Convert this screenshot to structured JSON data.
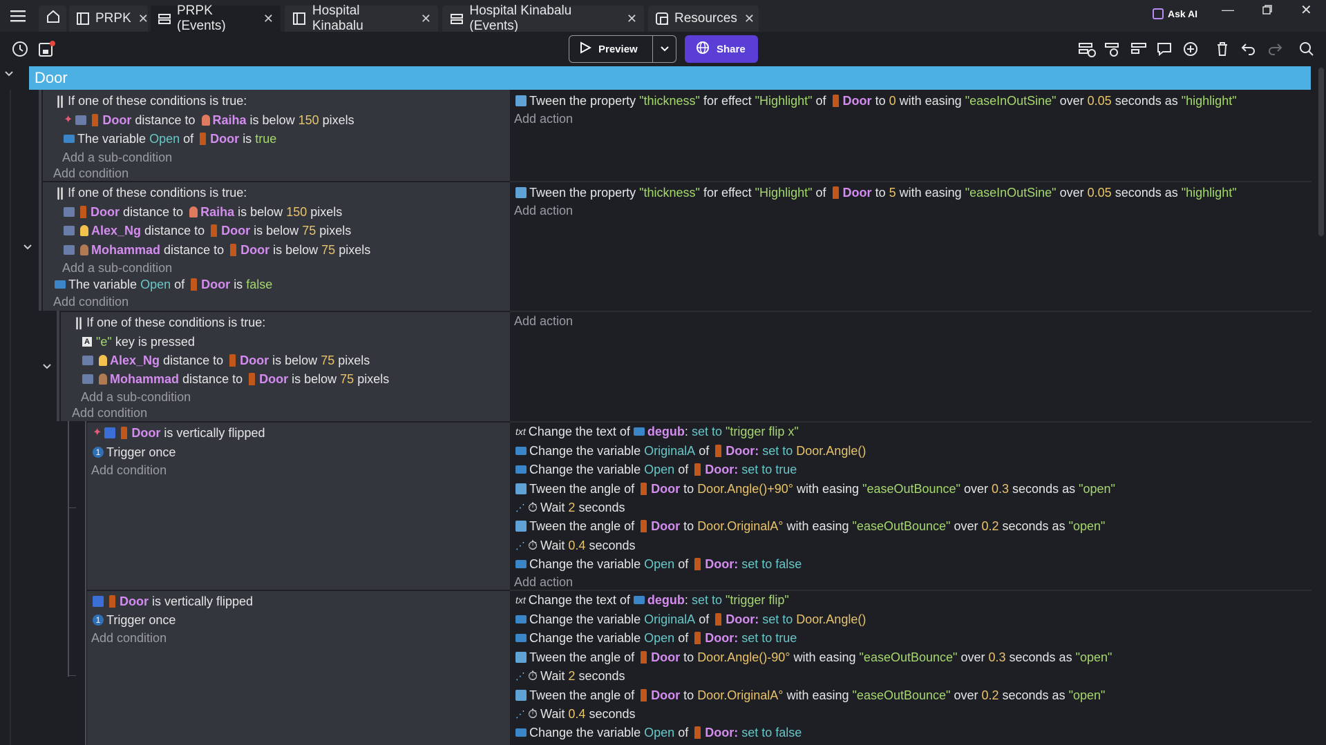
{
  "tabs": [
    {
      "label": "PRPK"
    },
    {
      "label": "PRPK (Events)"
    },
    {
      "label": "Hospital Kinabalu"
    },
    {
      "label": "Hospital Kinabalu (Events)"
    },
    {
      "label": "Resources"
    }
  ],
  "titlebar": {
    "ask_ai": "Ask AI"
  },
  "toolbar": {
    "preview": "Preview",
    "share": "Share"
  },
  "group": {
    "title": "Door"
  },
  "common": {
    "add_condition": "Add condition",
    "add_action": "Add action",
    "add_subcondition": "Add a sub-condition",
    "or_header": "If one of these conditions is true:"
  },
  "text": {
    "door": "Door",
    "raiha": "Raiha",
    "alex": "Alex_Ng",
    "mohammad": "Mohammad",
    "distance_to": "distance to",
    "is_below": "is below",
    "pixels": "pixels",
    "the_variable": "The variable",
    "of": "of",
    "is": "is",
    "open": "Open",
    "originalA": "OriginalA",
    "true": "true",
    "false": "false",
    "n150": "150",
    "n75": "75",
    "n0": "0",
    "n5": "5",
    "key_e": "\"e\"",
    "key_pressed": "key is pressed",
    "vflipped": "is vertically flipped",
    "trigger_once": "Trigger once",
    "tween_prop": "Tween the property",
    "thickness": "\"thickness\"",
    "for_effect": "for effect",
    "highlight_eff": "\"Highlight\"",
    "to": "to",
    "with_easing": "with easing",
    "easeInOutSine": "\"easeInOutSine\"",
    "over": "over",
    "n005": "0.05",
    "seconds_as": "seconds as",
    "highlight_id": "\"highlight\"",
    "change_text": "Change the text of",
    "degub": "degub",
    "set_to": "set to",
    "trigger_flip_x": "\"trigger flip x\"",
    "trigger_flip": "\"trigger flip\"",
    "change_var": "Change the variable",
    "door_colon": "Door:",
    "door_angle": "Door.Angle()",
    "tween_angle": "Tween the angle of",
    "angle_plus": "Door.Angle()+90°",
    "angle_minus": "Door.Angle()-90°",
    "easeOutBounce": "\"easeOutBounce\"",
    "n03": "0.3",
    "open_id": "\"open\"",
    "wait": "Wait",
    "n2": "2",
    "n04": "0.4",
    "seconds": "seconds",
    "door_origA": "Door.OriginalA°",
    "n02": "0.2",
    "set_to_true": "set to true",
    "set_to_false": "set to false"
  },
  "colors": {
    "accent": "#4db0e3",
    "share": "#5b3ed6",
    "object": "#d58cf0",
    "number": "#e9c46a",
    "string": "#a6d86e",
    "variable": "#68c7c8"
  }
}
